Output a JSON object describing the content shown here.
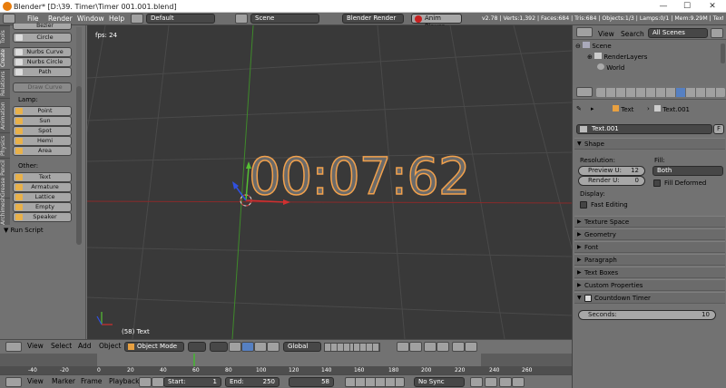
{
  "window": {
    "title": "Blender* [D:\\39. Timer\\Timer 001.001.blend]",
    "min": "—",
    "max": "☐",
    "close": "✕"
  },
  "info": {
    "menus": [
      "File",
      "Render",
      "Window",
      "Help"
    ],
    "screen_layout": "Default",
    "scene": "Scene",
    "engine": "Blender Render",
    "anim_player": "Anim Player",
    "stats": "v2.78 | Verts:1,392 | Faces:684 | Tris:684 | Objects:1/3 | Lamps:0/1 | Mem:9.29M | Text"
  },
  "toolshelf": {
    "tabs": [
      "Tools",
      "Create",
      "Relations",
      "Animation",
      "Physics",
      "Grease Pencil",
      "Archimesh"
    ],
    "curve_items": [
      "Bezier",
      "Circle",
      "Nurbs Curve",
      "Nurbs Circle",
      "Path"
    ],
    "draw_curve": "Draw Curve",
    "lamp_label": "Lamp:",
    "lamp_items": [
      "Point",
      "Sun",
      "Spot",
      "Hemi",
      "Area"
    ],
    "other_label": "Other:",
    "other_items": [
      "Text",
      "Armature",
      "Lattice",
      "Empty",
      "Speaker"
    ],
    "run_script": "Run Script"
  },
  "viewport": {
    "fps": "fps: 24",
    "object_label": "(58) Text",
    "text_object": "00:07:62"
  },
  "viewport_header": {
    "menus": [
      "View",
      "Select",
      "Add",
      "Object"
    ],
    "mode": "Object Mode",
    "orientation": "Global"
  },
  "timeline": {
    "ruler": [
      "-40",
      "-20",
      "0",
      "20",
      "40",
      "60",
      "80",
      "100",
      "120",
      "140",
      "160",
      "180",
      "200",
      "220",
      "240",
      "260"
    ],
    "current_frame_marker": 60,
    "menus": [
      "View",
      "Marker",
      "Frame",
      "Playback"
    ],
    "start_label": "Start:",
    "start": "1",
    "end_label": "End:",
    "end": "250",
    "current": "58",
    "sync": "No Sync"
  },
  "outliner": {
    "view": "View",
    "search": "Search",
    "filter": "All Scenes",
    "items": [
      "Scene",
      "RenderLayers",
      "World"
    ]
  },
  "properties": {
    "object": "Text",
    "data": "Text.001",
    "datablock": "Text.001",
    "fake_user": "F",
    "shape_panel": "Shape",
    "resolution_label": "Resolution:",
    "preview_u_label": "Preview U:",
    "preview_u": "12",
    "render_u_label": "Render U:",
    "render_u": "0",
    "fill_label": "Fill:",
    "fill_value": "Both",
    "fill_deformed": "Fill Deformed",
    "display_label": "Display:",
    "fast_editing": "Fast Editing",
    "panels": [
      "Texture Space",
      "Geometry",
      "Font",
      "Paragraph",
      "Text Boxes",
      "Custom Properties"
    ],
    "countdown_panel": "Countdown Timer",
    "seconds_label": "Seconds:",
    "seconds_value": "10"
  },
  "colors": {
    "orange_accent": "#e87d0d",
    "selection": "#f2a14c",
    "x_axis": "#c83232",
    "y_axis": "#56a033",
    "timeline_frame": "#4fa640"
  }
}
